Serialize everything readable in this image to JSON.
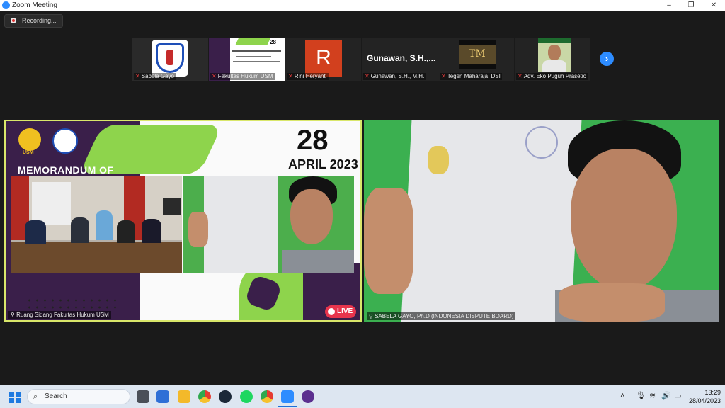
{
  "window": {
    "title": "Zoom Meeting",
    "minimize_glyph": "–",
    "restore_glyph": "❐",
    "close_glyph": "✕"
  },
  "recording": {
    "label": "Recording..."
  },
  "participants": [
    {
      "name": "Sabela Gayo"
    },
    {
      "name": "Fakultas Hukum USM"
    },
    {
      "name": "Rini Heryanti",
      "initial": "R"
    },
    {
      "name": "Gunawan, S.H., M.H.",
      "banner": "Gunawan, S.H.,..."
    },
    {
      "name": "Tegen Maharaja_DSI"
    },
    {
      "name": "Adv. Eko Puguh Prasetio"
    }
  ],
  "next_page_glyph": "›",
  "main_left": {
    "caption": "Ruang Sidang Fakultas Hukum USM",
    "slide": {
      "day": "28",
      "month_year": "APRIL 2023",
      "memo_title": "MEMORANDUM OF",
      "usm_label": "USM",
      "live_label": "LIVE"
    }
  },
  "main_right": {
    "caption": "SABELA GAYO, Ph.D (INDONESIA DISPUTE BOARD)"
  },
  "taskbar": {
    "search_placeholder": "Search",
    "time": "13:29",
    "date": "28/04/2023",
    "icons": [
      "task-view-icon",
      "store-icon",
      "file-explorer-icon",
      "chrome-icon",
      "steam-icon",
      "spotify-icon",
      "chrome-profile-icon",
      "zoom-icon",
      "media-player-icon"
    ],
    "tray_icons": [
      "chevron-up-icon",
      "microphone-icon",
      "wifi-icon",
      "volume-icon",
      "battery-icon"
    ]
  },
  "colors": {
    "zoom_blue": "#2d8cff",
    "active_speaker_border": "#d9e76a",
    "slide_green": "#8ed44c",
    "slide_purple": "#3a1f4a",
    "live_red": "#e8354d"
  }
}
